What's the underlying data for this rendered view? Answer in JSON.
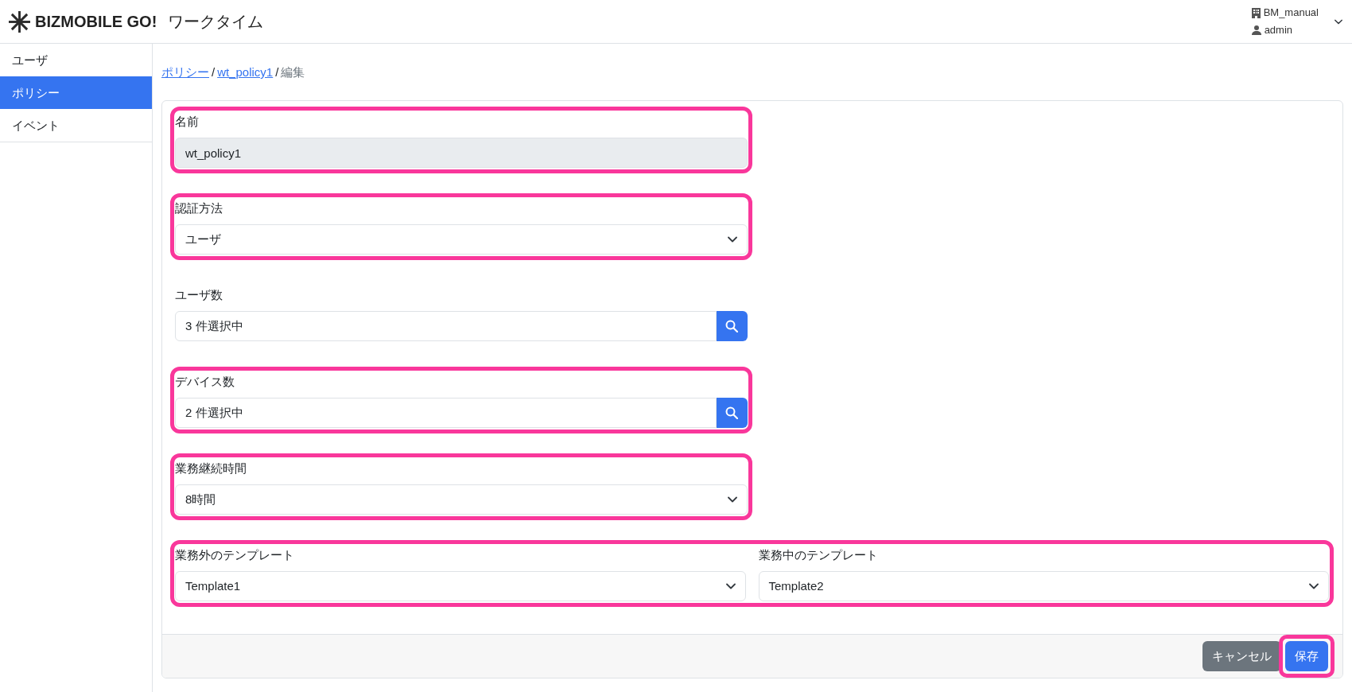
{
  "header": {
    "brand": "BIZMOBILE GO!",
    "app_name": "ワークタイム",
    "tenant": "BM_manual",
    "user": "admin"
  },
  "sidebar": {
    "items": [
      {
        "label": "ユーザ",
        "selected": false
      },
      {
        "label": "ポリシー",
        "selected": true
      },
      {
        "label": "イベント",
        "selected": false
      }
    ]
  },
  "breadcrumb": [
    {
      "kind": "link",
      "text": "ポリシー"
    },
    {
      "kind": "separator",
      "text": "/"
    },
    {
      "kind": "link",
      "text": "wt_policy1"
    },
    {
      "kind": "separator",
      "text": "/"
    },
    {
      "kind": "current",
      "text": "編集"
    }
  ],
  "form": {
    "fields": [
      {
        "kind": "readonly",
        "label": "名前",
        "value": "wt_policy1",
        "highlighted": true
      },
      {
        "kind": "select",
        "label": "認証方法",
        "value": "ユーザ",
        "highlighted": true
      },
      {
        "kind": "picker",
        "label": "ユーザ数",
        "value": "3 件選択中",
        "highlighted": false
      },
      {
        "kind": "picker",
        "label": "デバイス数",
        "value": "2 件選択中",
        "highlighted": true
      },
      {
        "kind": "select",
        "label": "業務継続時間",
        "value": "8時間",
        "highlighted": true
      }
    ],
    "template_row": {
      "highlighted": true,
      "fields": [
        {
          "label": "業務外のテンプレート",
          "value": "Template1"
        },
        {
          "label": "業務中のテンプレート",
          "value": "Template2"
        }
      ]
    }
  },
  "footer": {
    "buttons": [
      {
        "kind": "secondary",
        "label": "キャンセル",
        "highlighted": false
      },
      {
        "kind": "primary",
        "label": "保存",
        "highlighted": true
      }
    ]
  }
}
